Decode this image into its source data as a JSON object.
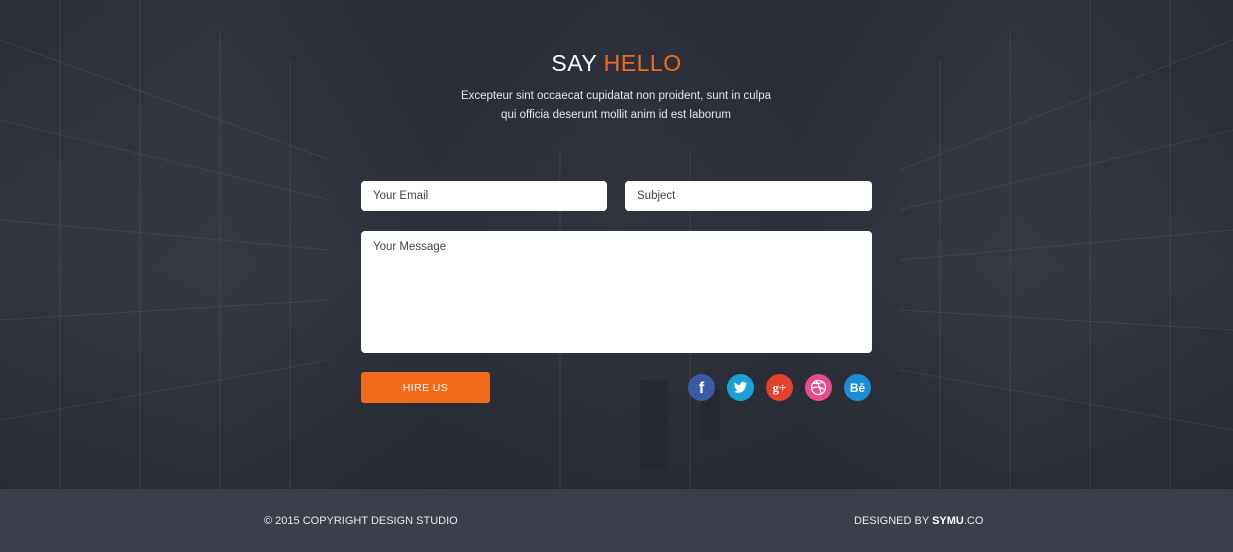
{
  "hero": {
    "title_plain": "SAY",
    "title_accent": "HELLO",
    "subtitle_line1": "Excepteur sint occaecat cupidatat non proident, sunt in culpa",
    "subtitle_line2": "qui officia deserunt mollit anim id est laborum"
  },
  "form": {
    "email_placeholder": "Your Email",
    "subject_placeholder": "Subject",
    "message_placeholder": "Your Message",
    "submit_label": "HIRE US"
  },
  "social": [
    {
      "icon": "facebook-icon",
      "glyph": "f",
      "color": "#3b5ba8"
    },
    {
      "icon": "twitter-icon",
      "glyph": "t",
      "color": "#1d9fd8"
    },
    {
      "icon": "google-plus-icon",
      "glyph": "g+",
      "color": "#e5412d"
    },
    {
      "icon": "dribbble-icon",
      "glyph": "",
      "color": "#ea4c89"
    },
    {
      "icon": "behance-icon",
      "glyph": "Bē",
      "color": "#1a8ed6"
    }
  ],
  "footer": {
    "copyright": "© 2015 COPYRIGHT DESIGN STUDIO",
    "designed_prefix": "DESIGNED BY",
    "designed_brand": "SYMU",
    "designed_suffix": ".CO"
  },
  "colors": {
    "accent": "#f26b1d",
    "footer_bg": "#3a3f4b"
  }
}
